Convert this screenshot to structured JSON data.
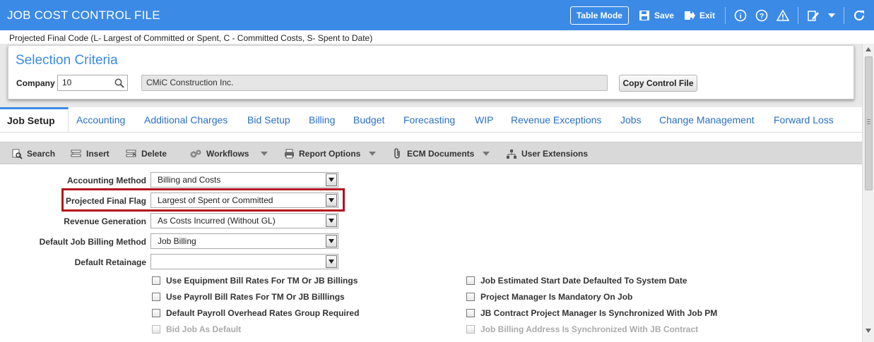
{
  "header": {
    "title": "JOB COST CONTROL FILE",
    "table_mode": "Table Mode",
    "save": "Save",
    "exit": "Exit",
    "accent": "#3b8ae6"
  },
  "hint": "Projected Final Code (L- Largest of Committed or Spent, C - Committed Costs, S- Spent to Date)",
  "selection": {
    "title": "Selection Criteria",
    "company_label": "Company",
    "company_value": "10",
    "company_name": "CMiC Construction Inc.",
    "copy_button": "Copy Control File"
  },
  "tabs": [
    "Job Setup",
    "Accounting",
    "Additional Charges",
    "Bid Setup",
    "Billing",
    "Budget",
    "Forecasting",
    "WIP",
    "Revenue Exceptions",
    "Jobs",
    "Change Management",
    "Forward Loss"
  ],
  "toolbar": {
    "search": "Search",
    "insert": "Insert",
    "delete": "Delete",
    "workflows": "Workflows",
    "report_options": "Report Options",
    "ecm_documents": "ECM Documents",
    "user_extensions": "User Extensions"
  },
  "form": {
    "accounting_method": {
      "label": "Accounting Method",
      "value": "Billing and Costs"
    },
    "projected_final_flag": {
      "label": "Projected Final Flag",
      "value": "Largest of Spent or Committed"
    },
    "revenue_generation": {
      "label": "Revenue Generation",
      "value": "As Costs Incurred (Without GL)"
    },
    "default_job_billing_method": {
      "label": "Default Job Billing Method",
      "value": "Job Billing"
    },
    "default_retainage": {
      "label": "Default Retainage",
      "value": ""
    }
  },
  "checkboxes_left": [
    "Use Equipment Bill Rates For TM Or JB Billings",
    "Use Payroll Bill Rates For TM Or JB Billlings",
    "Default Payroll Overhead Rates Group Required",
    "Bid Job As Default"
  ],
  "checkboxes_right": [
    "Job Estimated Start Date Defaulted To System Date",
    "Project Manager Is Mandatory On Job",
    "JB Contract Project Manager Is Synchronized With Job PM",
    "Job Billing Address Is Synchronized With JB Contract"
  ]
}
